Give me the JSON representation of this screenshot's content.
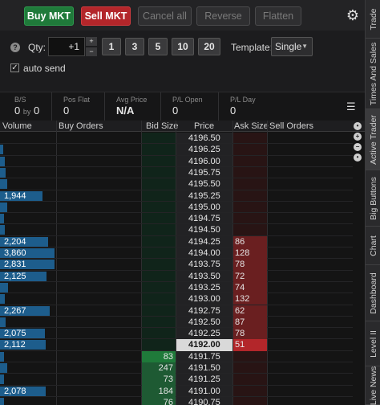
{
  "toolbar": {
    "buy_label": "Buy MKT",
    "sell_label": "Sell MKT",
    "cancel_label": "Cancel all",
    "reverse_label": "Reverse",
    "flatten_label": "Flatten"
  },
  "order": {
    "qty_label": "Qty:",
    "qty_value": "+1",
    "qty_presets": [
      "1",
      "3",
      "5",
      "10",
      "20"
    ],
    "template_label": "Template:",
    "template_value": "Single",
    "auto_send_label": "auto send",
    "auto_send_checked": true
  },
  "stats": {
    "bs_caption": "B/S",
    "bs_left": "0",
    "bs_by": "by",
    "bs_right": "0",
    "pos_flat_caption": "Pos Flat",
    "pos_flat_value": "0",
    "avg_price_caption": "Avg Price",
    "avg_price_value": "N/A",
    "pl_open_caption": "P/L Open",
    "pl_open_value": "0",
    "pl_day_caption": "P/L Day",
    "pl_day_value": "0"
  },
  "ladder": {
    "headers": {
      "volume": "Volume",
      "buy_orders": "Buy Orders",
      "bid_size": "Bid Size",
      "price": "Price",
      "ask_size": "Ask Size",
      "sell_orders": "Sell Orders"
    },
    "colors": {
      "bid": "#1e5a33",
      "ask": "#6a1f20",
      "last_bid": "#1f7a3a",
      "last_ask": "#b3262a",
      "volume": "#1d5d8c"
    },
    "max_volume": 2500,
    "rows": [
      {
        "price": "4196.50",
        "volume": 0,
        "volume_label": "",
        "bid": "",
        "ask": ""
      },
      {
        "price": "4196.25",
        "volume": 150,
        "volume_label": "",
        "bid": "",
        "ask": ""
      },
      {
        "price": "4196.00",
        "volume": 230,
        "volume_label": "",
        "bid": "",
        "ask": ""
      },
      {
        "price": "4195.75",
        "volume": 240,
        "volume_label": "",
        "bid": "",
        "ask": ""
      },
      {
        "price": "4195.50",
        "volume": 330,
        "volume_label": "",
        "bid": "",
        "ask": ""
      },
      {
        "price": "4195.25",
        "volume": 1944,
        "volume_label": "1,944",
        "bid": "",
        "ask": ""
      },
      {
        "price": "4195.00",
        "volume": 330,
        "volume_label": "",
        "bid": "",
        "ask": ""
      },
      {
        "price": "4194.75",
        "volume": 200,
        "volume_label": "",
        "bid": "",
        "ask": ""
      },
      {
        "price": "4194.50",
        "volume": 220,
        "volume_label": "",
        "bid": "",
        "ask": ""
      },
      {
        "price": "4194.25",
        "volume": 2204,
        "volume_label": "2,204",
        "bid": "",
        "ask": "86"
      },
      {
        "price": "4194.00",
        "volume": 3860,
        "volume_label": "3,860",
        "bid": "",
        "ask": "128"
      },
      {
        "price": "4193.75",
        "volume": 2831,
        "volume_label": "2,831",
        "bid": "",
        "ask": "78"
      },
      {
        "price": "4193.50",
        "volume": 2125,
        "volume_label": "2,125",
        "bid": "",
        "ask": "72"
      },
      {
        "price": "4193.25",
        "volume": 350,
        "volume_label": "",
        "bid": "",
        "ask": "74"
      },
      {
        "price": "4193.00",
        "volume": 230,
        "volume_label": "",
        "bid": "",
        "ask": "132"
      },
      {
        "price": "4192.75",
        "volume": 2267,
        "volume_label": "2,267",
        "bid": "",
        "ask": "62"
      },
      {
        "price": "4192.50",
        "volume": 240,
        "volume_label": "",
        "bid": "",
        "ask": "87"
      },
      {
        "price": "4192.25",
        "volume": 2075,
        "volume_label": "2,075",
        "bid": "",
        "ask": "78"
      },
      {
        "price": "4192.00",
        "volume": 2112,
        "volume_label": "2,112",
        "bid": "",
        "ask": "51",
        "current": true
      },
      {
        "price": "4191.75",
        "volume": 200,
        "volume_label": "",
        "bid": "83",
        "ask": ""
      },
      {
        "price": "4191.50",
        "volume": 320,
        "volume_label": "",
        "bid": "247",
        "ask": ""
      },
      {
        "price": "4191.25",
        "volume": 180,
        "volume_label": "",
        "bid": "73",
        "ask": ""
      },
      {
        "price": "4191.00",
        "volume": 2078,
        "volume_label": "2,078",
        "bid": "184",
        "ask": ""
      },
      {
        "price": "4190.75",
        "volume": 180,
        "volume_label": "",
        "bid": "76",
        "ask": ""
      }
    ]
  },
  "tabs": [
    "Trade",
    "Times And Sales",
    "Active Trader",
    "Big Buttons",
    "Chart",
    "Dashboard",
    "Level II",
    "Live News"
  ]
}
